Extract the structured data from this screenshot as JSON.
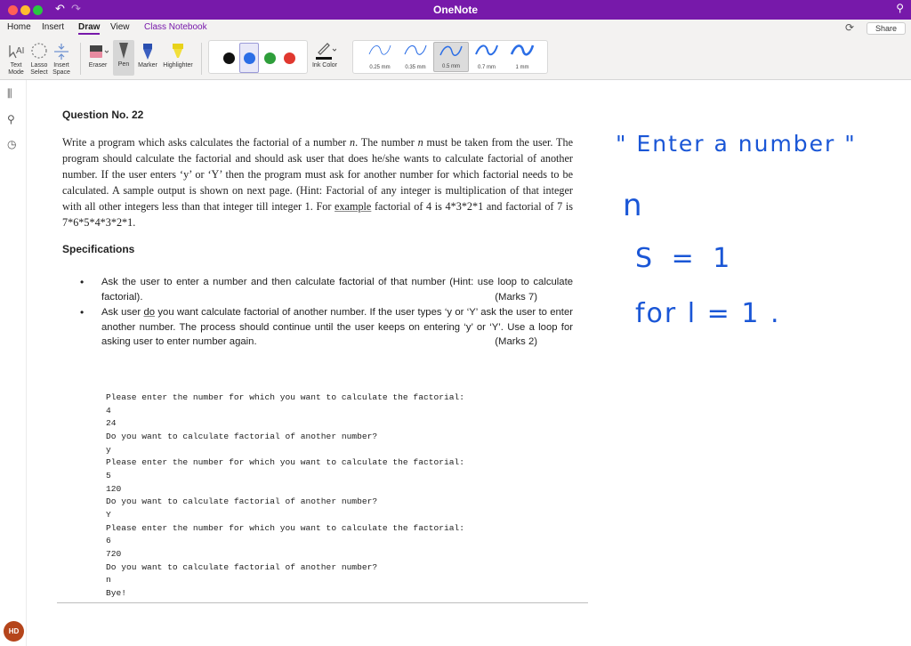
{
  "window": {
    "title": "OneNote"
  },
  "tabs": [
    {
      "label": "Home"
    },
    {
      "label": "Insert"
    },
    {
      "label": "Draw"
    },
    {
      "label": "View"
    },
    {
      "label": "Class Notebook"
    }
  ],
  "share_label": "Share",
  "ribbon": {
    "text_mode": "Text Mode",
    "lasso_select": "Lasso Select",
    "insert_space": "Insert Space",
    "eraser": "Eraser",
    "pen": "Pen",
    "marker": "Marker",
    "highlighter": "Highlighter",
    "ink_color": "Ink Color",
    "thicknesses": [
      "0.25 mm",
      "0.35 mm",
      "0.5 mm",
      "0.7 mm",
      "1 mm"
    ],
    "selected_thickness": "0.5 mm",
    "colors": [
      "#111111",
      "#2b6ee6",
      "#2e9e3a",
      "#e0382f"
    ],
    "accent": "#7719aa"
  },
  "user": {
    "initials": "HD"
  },
  "question": {
    "title": "Question No. 22",
    "body_1": "Write a program which asks calculates the factorial of a number ",
    "var_n": "n",
    "body_2": ". The number ",
    "body_3": " must be taken from the user. The program should calculate the factorial and should ask user that does he/she wants to calculate factorial of another number. If the user enters ‘y’ or ‘Y’ then the program must ask for another number for which factorial needs to be calculated.  A sample output is shown on next page.  (Hint: Factorial of any integer is multiplication of that integer with all other integers less than that integer till integer 1. For ",
    "body_ul": "example",
    "body_4": " factorial of 4 is 4*3*2*1 and factorial of 7 is 7*6*5*4*3*2*1."
  },
  "specifications": {
    "title": "Specifications",
    "bullet_1": "Ask the user to enter a number and then calculate factorial of that number (Hint: use loop to calculate factorial).",
    "bullet_1_marks": "(Marks 7)",
    "bullet_2_a": "Ask user ",
    "bullet_2_do": "do",
    "bullet_2_b": " you want calculate factorial of another number. If the user types ‘y or ‘Y’ ask the user to enter another number. The process should continue until the user keeps on entering ‘y’ or ‘Y’. Use a loop for asking user to enter number again.",
    "bullet_2_marks": "(Marks 2)"
  },
  "sample_output": [
    "Please enter the number for which you want to calculate the factorial:",
    "4",
    "24",
    "Do you want to calculate factorial of another number?",
    "y",
    "Please enter the number for which you want to calculate the factorial:",
    "5",
    "120",
    "Do you want to calculate factorial of another number?",
    "Y",
    "Please enter the number for which you want to calculate the factorial:",
    "6",
    "720",
    "Do you want to calculate factorial of another number?",
    "n",
    "Bye!"
  ],
  "handwriting": {
    "ink_color": "#1a56d6",
    "line_1": "\" Enter  a  number \"",
    "line_2": "n",
    "line_3": "S = 1",
    "line_4": "for  l = 1 ."
  }
}
